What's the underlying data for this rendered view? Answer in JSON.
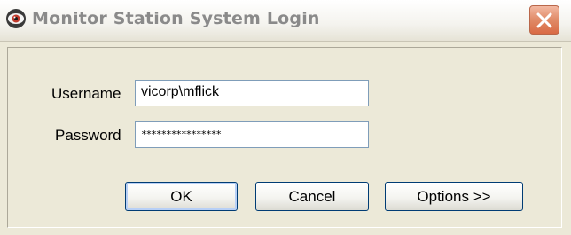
{
  "window": {
    "title": "Monitor Station System Login"
  },
  "form": {
    "username_label": "Username",
    "username_value": "vicorp\\mflick",
    "password_label": "Password",
    "password_value": "****************"
  },
  "buttons": {
    "ok_label": "OK",
    "cancel_label": "Cancel",
    "options_label": "Options >>"
  },
  "icons": {
    "app": "eye-icon",
    "close": "close-icon"
  },
  "colors": {
    "close_button": "#d96a44",
    "eye_iris": "#c0392b"
  }
}
